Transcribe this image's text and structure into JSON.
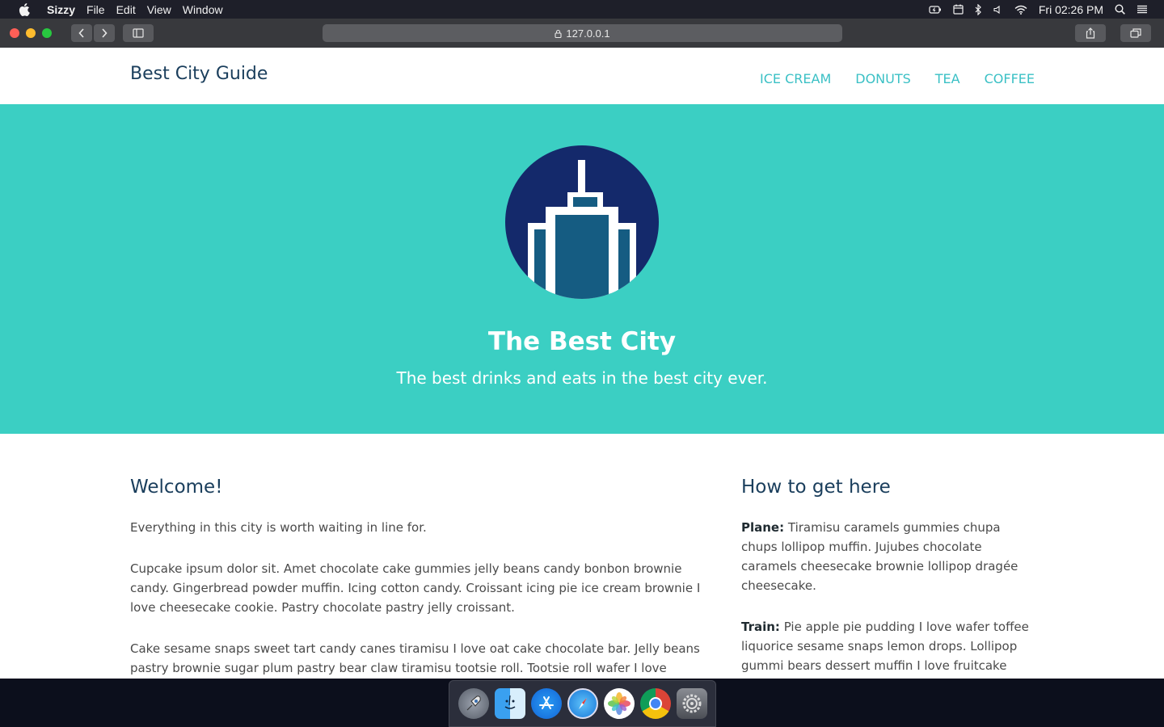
{
  "menubar": {
    "app_name": "Sizzy",
    "items": [
      "File",
      "Edit",
      "View",
      "Window"
    ],
    "clock": "Fri 02:26 PM"
  },
  "browser": {
    "url": "127.0.0.1"
  },
  "site": {
    "brand": "Best City Guide",
    "nav": [
      "ICE CREAM",
      "DONUTS",
      "TEA",
      "COFFEE"
    ]
  },
  "hero": {
    "title": "The Best City",
    "subtitle": "The best drinks and eats in the best city ever."
  },
  "welcome": {
    "heading": "Welcome!",
    "paragraphs": [
      "Everything in this city is worth waiting in line for.",
      "Cupcake ipsum dolor sit. Amet chocolate cake gummies jelly beans candy bonbon brownie candy. Gingerbread powder muffin. Icing cotton candy. Croissant icing pie ice cream brownie I love cheesecake cookie. Pastry chocolate pastry jelly croissant.",
      "Cake sesame snaps sweet tart candy canes tiramisu I love oat cake chocolate bar. Jelly beans pastry brownie sugar plum pastry bear claw tiramisu tootsie roll. Tootsie roll wafer I love chocolate donuts."
    ]
  },
  "directions": {
    "heading": "How to get here",
    "items": [
      {
        "label": "Plane:",
        "text": " Tiramisu caramels gummies chupa chups lollipop muffin. Jujubes chocolate caramels cheesecake brownie lollipop dragée cheesecake."
      },
      {
        "label": "Train:",
        "text": " Pie apple pie pudding I love wafer toffee liquorice sesame snaps lemon drops. Lollipop gummi bears dessert muffin I love fruitcake toffee pie."
      }
    ]
  },
  "dock": {
    "apps": [
      "launchpad-icon",
      "finder-icon",
      "app-store-icon",
      "safari-icon",
      "photos-icon",
      "chrome-icon",
      "system-preferences-icon"
    ]
  },
  "colors": {
    "hero_bg": "#3bcfc3",
    "nav_link": "#3ac0c5",
    "heading": "#1a3e5c",
    "logo_circle": "#14296b",
    "logo_building": "#155c82"
  }
}
